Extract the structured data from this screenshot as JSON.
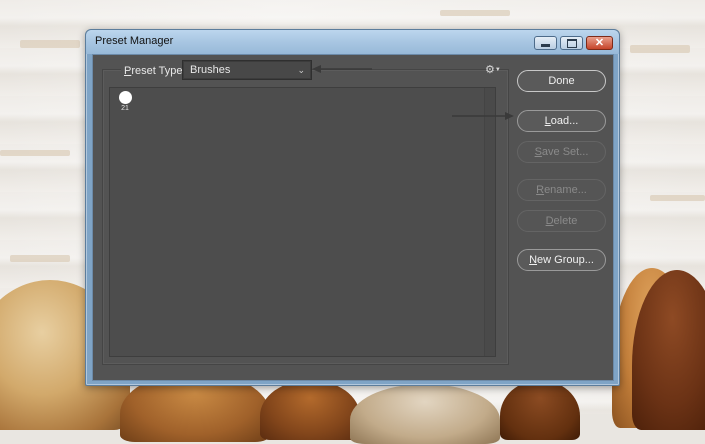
{
  "window": {
    "title": "Preset Manager"
  },
  "preset_type": {
    "label_prefix": "P",
    "label_rest": "reset Type:",
    "selected": "Brushes"
  },
  "brushes": [
    {
      "size": "21"
    }
  ],
  "buttons": {
    "done": "Done",
    "load_u": "L",
    "load_rest": "oad...",
    "saveset_u": "S",
    "saveset_rest": "ave Set...",
    "rename_u": "R",
    "rename_rest": "ename...",
    "delete_u": "D",
    "delete_rest": "elete",
    "newgroup_u": "N",
    "newgroup_rest": "ew Group..."
  },
  "colors": {
    "dialog_bg": "#535353",
    "titlebar": "#a8c6e2",
    "close_button": "#c6442a"
  }
}
